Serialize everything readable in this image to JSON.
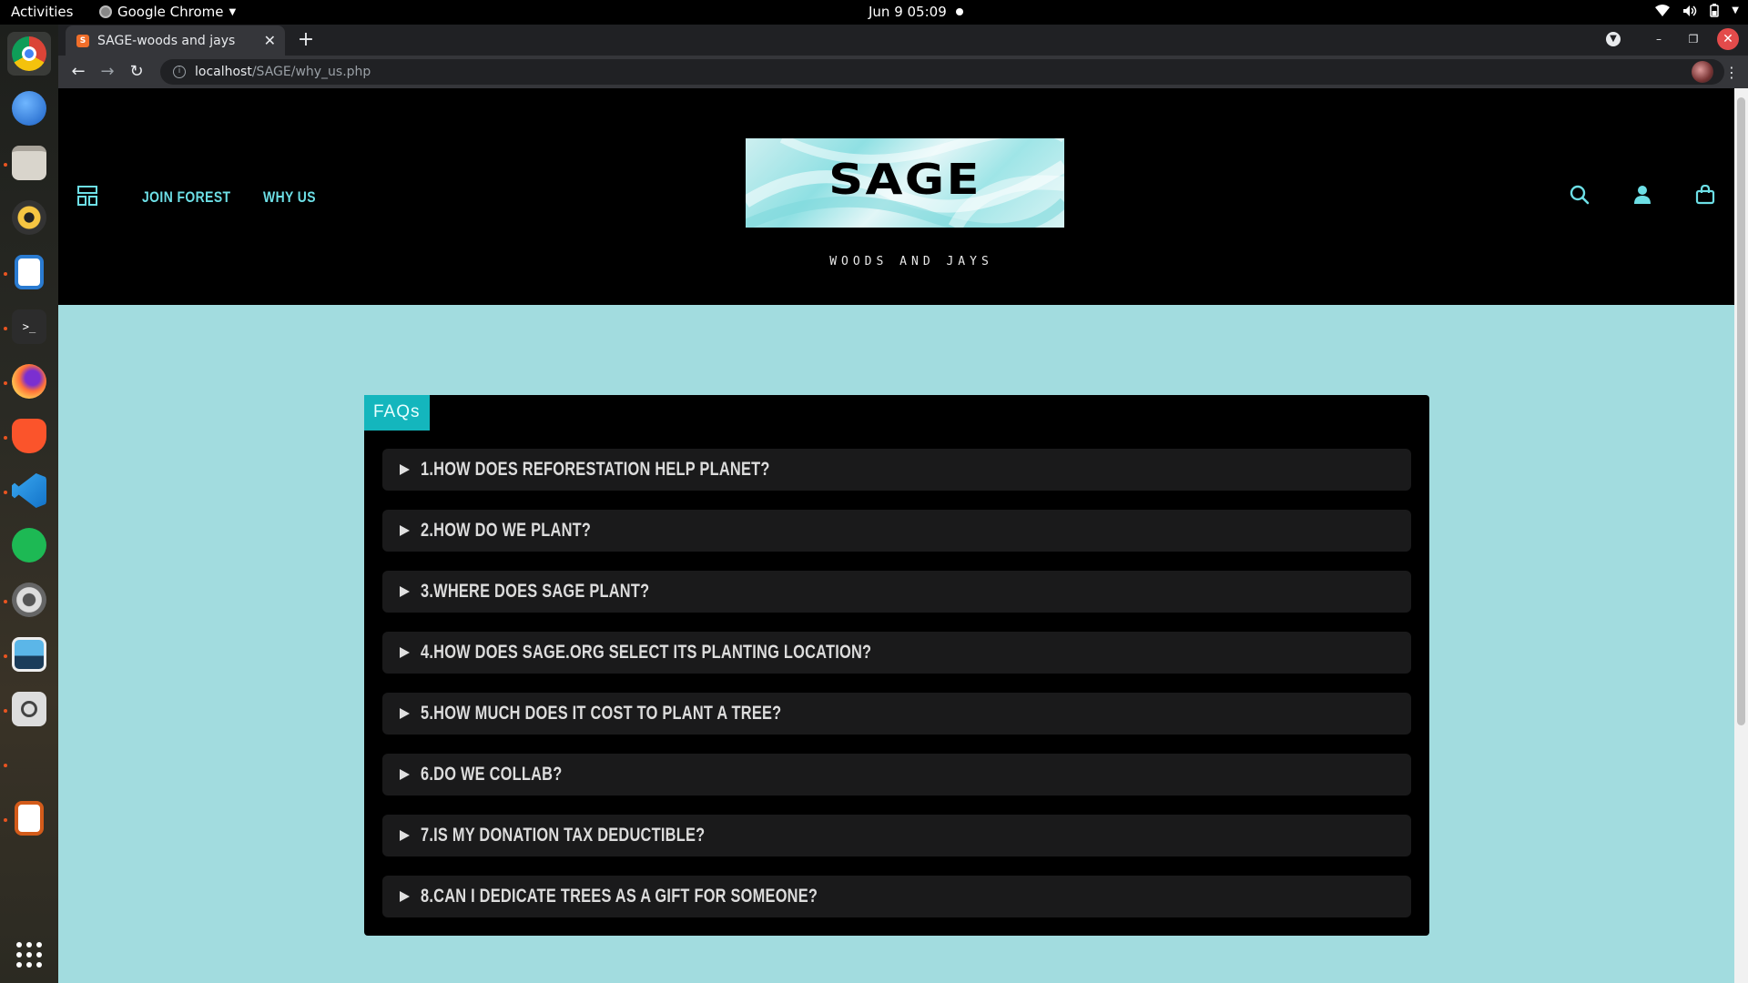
{
  "system": {
    "activities": "Activities",
    "app_name": "Google Chrome",
    "clock": "Jun 9  05:09"
  },
  "browser": {
    "tab_title": "SAGE-woods and jays",
    "url_host": "localhost",
    "url_path": "/SAGE/why_us.php"
  },
  "site": {
    "nav": [
      "JOIN FOREST",
      "WHY US"
    ],
    "logo_text": "SAGE",
    "tagline": "WOODS AND JAYS",
    "colors": {
      "accent": "#6ddfe6",
      "page_bg": "#a2dcdf",
      "badge": "#14b6bd"
    }
  },
  "faq": {
    "badge": "FAQs",
    "items": [
      "1.HOW DOES REFORESTATION HELP PLANET?",
      "2.HOW DO WE PLANT?",
      "3.WHERE DOES SAGE PLANT?",
      "4.HOW DOES SAGE.ORG SELECT ITS PLANTING LOCATION?",
      "5.HOW MUCH DOES IT COST TO PLANT A TREE?",
      "6.DO WE COLLAB?",
      "7.IS MY DONATION TAX DEDUCTIBLE?",
      "8.CAN I DEDICATE TREES AS A GIFT FOR SOMEONE?"
    ]
  }
}
